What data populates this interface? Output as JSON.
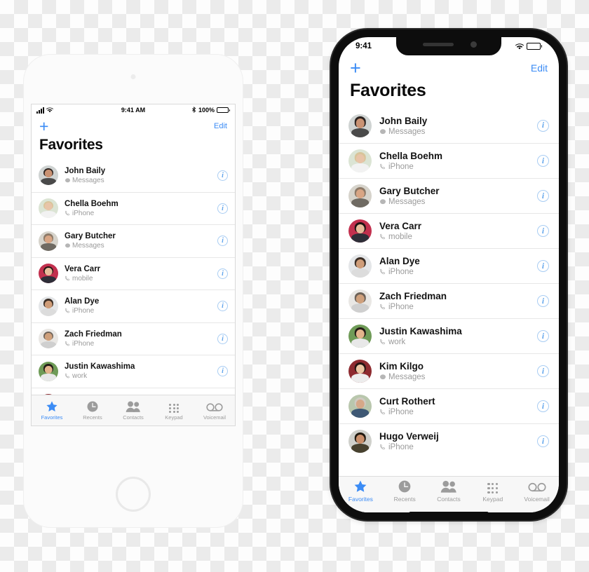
{
  "background": {
    "type": "transparency-checkerboard",
    "light": "#fdfdfd",
    "dark": "#ebebeb"
  },
  "accent_color": "#3c8cf5",
  "devices": [
    {
      "id": "left",
      "model_style": "iphone-8-white",
      "status_bar": {
        "time": "9:41 AM",
        "signal_icon": "cellular-bars-icon",
        "wifi_icon": "wifi-icon",
        "bluetooth_icon": "bluetooth-icon",
        "battery_percent": "100%",
        "battery_icon": "battery-full-icon"
      },
      "nav": {
        "add_label": "+",
        "edit_label": "Edit"
      },
      "title": "Favorites"
    },
    {
      "id": "right",
      "model_style": "iphone-x-black",
      "status_bar": {
        "time": "9:41",
        "signal_icon": "cellular-bars-icon",
        "wifi_icon": "wifi-icon",
        "battery_icon": "battery-full-icon"
      },
      "nav": {
        "add_label": "+",
        "edit_label": "Edit"
      },
      "title": "Favorites"
    }
  ],
  "favorites": [
    {
      "name": "John Baily",
      "subtitle": "Messages",
      "sub_icon": "message-bubble-icon",
      "info_icon": "info-circle-icon",
      "avatar_bg": "#cfd3d2",
      "hair": "#2b2320",
      "skin": "#c99273",
      "shirt": "#4a4a4a"
    },
    {
      "name": "Chella Boehm",
      "subtitle": "iPhone",
      "sub_icon": "phone-handset-icon",
      "info_icon": "info-circle-icon",
      "avatar_bg": "#dbe4d4",
      "hair": "#d8c49a",
      "skin": "#e8c4a8",
      "shirt": "#f2f2f2"
    },
    {
      "name": "Gary Butcher",
      "subtitle": "Messages",
      "sub_icon": "message-bubble-icon",
      "info_icon": "info-circle-icon",
      "avatar_bg": "#d6d3cb",
      "hair": "#8d7a68",
      "skin": "#d8a584",
      "shirt": "#6f6a62"
    },
    {
      "name": "Vera Carr",
      "subtitle": "mobile",
      "sub_icon": "phone-handset-icon",
      "info_icon": "info-circle-icon",
      "avatar_bg": "#c2304e",
      "hair": "#1d1512",
      "skin": "#e7bb9b",
      "shirt": "#2e2e38"
    },
    {
      "name": "Alan Dye",
      "subtitle": "iPhone",
      "sub_icon": "phone-handset-icon",
      "info_icon": "info-circle-icon",
      "avatar_bg": "#e4e6e8",
      "hair": "#3a2e26",
      "skin": "#cf9d79",
      "shirt": "#dcdcdc"
    },
    {
      "name": "Zach Friedman",
      "subtitle": "iPhone",
      "sub_icon": "phone-handset-icon",
      "info_icon": "info-circle-icon",
      "avatar_bg": "#e9e7e4",
      "hair": "#6d6258",
      "skin": "#cfa07c",
      "shirt": "#cfcfcf"
    },
    {
      "name": "Justin Kawashima",
      "subtitle": "work",
      "sub_icon": "phone-handset-icon",
      "info_icon": "info-circle-icon",
      "avatar_bg": "#6f9b57",
      "hair": "#241c17",
      "skin": "#e3b48c",
      "shirt": "#e8e8e8"
    },
    {
      "name": "Kim Kilgo",
      "subtitle": "Messages",
      "sub_icon": "message-bubble-icon",
      "info_icon": "info-circle-icon",
      "avatar_bg": "#8e2b30",
      "hair": "#241612",
      "skin": "#ecc6a4",
      "shirt": "#ededed"
    },
    {
      "name": "Curt Rothert",
      "subtitle": "iPhone",
      "sub_icon": "phone-handset-icon",
      "info_icon": "info-circle-icon",
      "avatar_bg": "#b9c7ad",
      "hair": "#cfcac2",
      "skin": "#d6a888",
      "shirt": "#3e5874"
    },
    {
      "name": "Hugo Verweij",
      "subtitle": "iPhone",
      "sub_icon": "phone-handset-icon",
      "info_icon": "info-circle-icon",
      "avatar_bg": "#cfd0cb",
      "hair": "#20190f",
      "skin": "#c98f6b",
      "shirt": "#47412f"
    }
  ],
  "tabbar": {
    "items": [
      {
        "label": "Favorites",
        "icon": "star-icon",
        "active": true
      },
      {
        "label": "Recents",
        "icon": "clock-icon",
        "active": false
      },
      {
        "label": "Contacts",
        "icon": "people-icon",
        "active": false
      },
      {
        "label": "Keypad",
        "icon": "keypad-icon",
        "active": false
      },
      {
        "label": "Voicemail",
        "icon": "voicemail-icon",
        "active": false
      }
    ]
  }
}
